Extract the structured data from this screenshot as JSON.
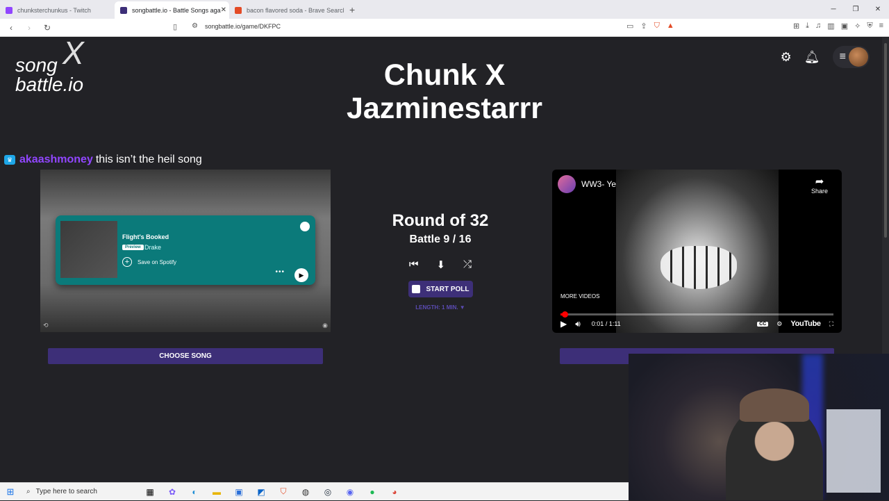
{
  "browser": {
    "tabs": [
      {
        "title": "chunksterchunkus - Twitch",
        "favicon_color": "#9146ff"
      },
      {
        "title": "songbattle.io - Battle Songs aga",
        "favicon_color": "#3d2f78"
      },
      {
        "title": "bacon flavored soda - Brave Search",
        "favicon_color": "#e34b26"
      }
    ],
    "tab_close": "✕",
    "new_tab": "+",
    "url": "songbattle.io/game/DKFPC"
  },
  "site": {
    "logo_line1": "song",
    "logo_line2": "battle.io",
    "logo_x": "X",
    "title_line1": "Chunk X",
    "title_line2": "Jazminestarrr"
  },
  "chat": {
    "username": "akaashmoney",
    "message": "this isn’t the heil song"
  },
  "left_player": {
    "track_title": "Flight's Booked",
    "preview_label": "Preview",
    "artist": "Drake",
    "save_label": "Save on Spotify",
    "choose_label": "CHOOSE SONG"
  },
  "center": {
    "round": "Round of 32",
    "battle": "Battle 9 / 16",
    "start_poll": "START POLL",
    "length": "LENGTH: 1 MIN. ▼"
  },
  "right_player": {
    "video_title": "WW3- Ye",
    "share_label": "Share",
    "more_videos": "MORE VIDEOS",
    "time": "0:01 / 1:11",
    "youtube_label": "YouTube",
    "progress_fraction": 0.014
  },
  "taskbar": {
    "search_placeholder": "Type here to search"
  }
}
